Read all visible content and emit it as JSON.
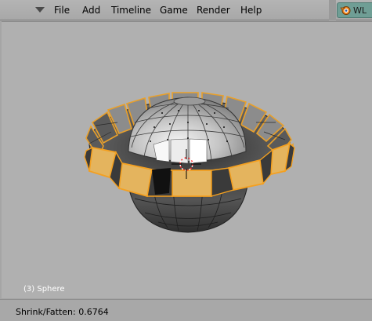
{
  "menubar": {
    "items": [
      {
        "label": "File"
      },
      {
        "label": "Add"
      },
      {
        "label": "Timeline"
      },
      {
        "label": "Game"
      },
      {
        "label": "Render"
      },
      {
        "label": "Help"
      }
    ],
    "scene_label": "WL"
  },
  "viewport": {
    "object_label": "(3) Sphere"
  },
  "status": {
    "text": "Shrink/Fatten: 0.6764"
  },
  "colors": {
    "selected_face": "#e4b45e",
    "selected_edge": "#f4a020",
    "background": "#b0b0b0"
  }
}
